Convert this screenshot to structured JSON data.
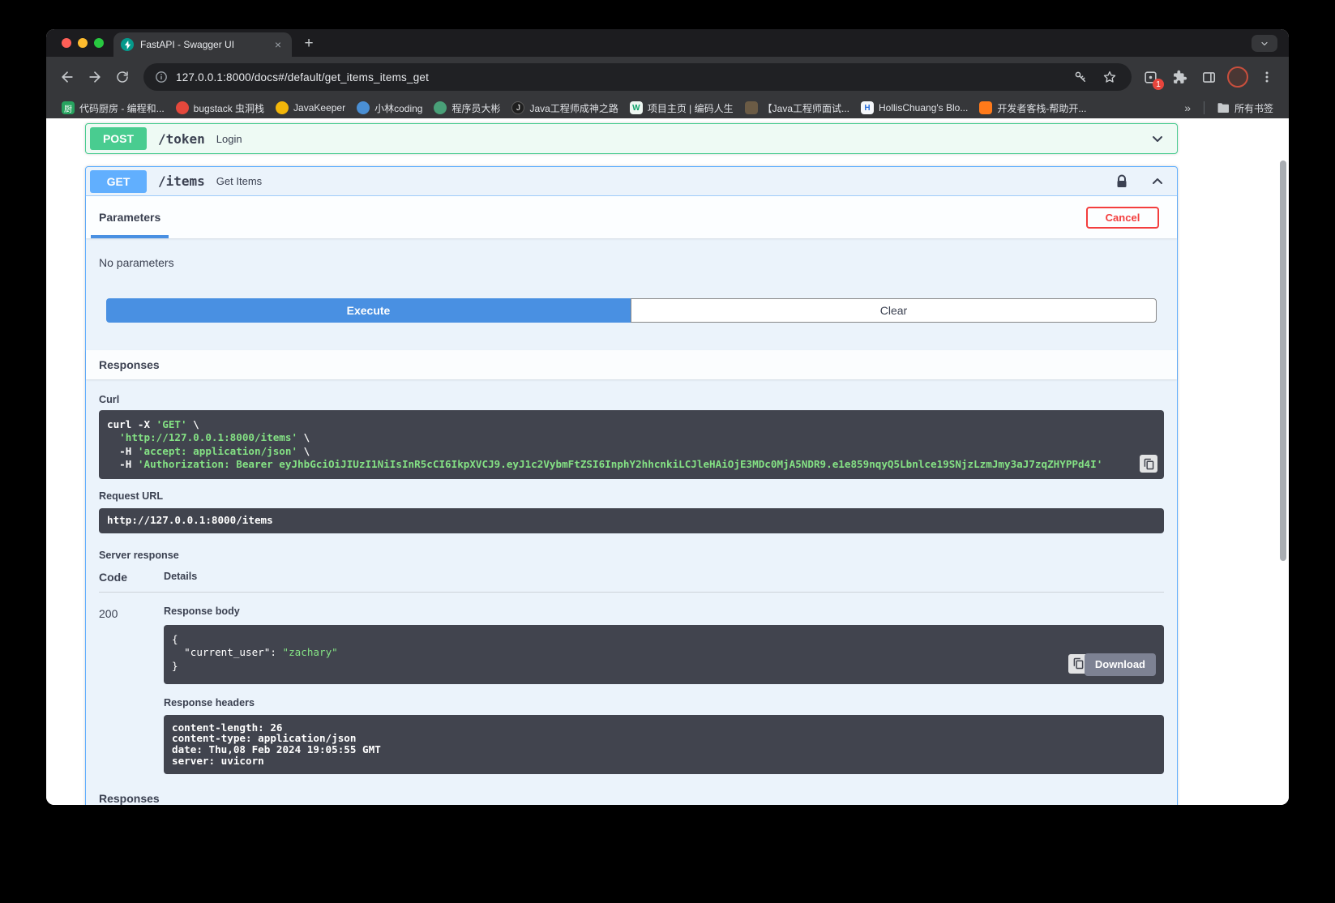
{
  "colors": {
    "get_accent": "#61affe",
    "post_accent": "#49cc90",
    "execute_blue": "#4990e2",
    "cancel_red": "#f33e3e",
    "code_background": "#41444e",
    "code_string_green": "#84e184",
    "download_gray": "#7d8293"
  },
  "browser": {
    "tab_title": "FastAPI - Swagger UI",
    "tab_close_glyph": "×",
    "new_tab_glyph": "+",
    "url": "127.0.0.1:8000/docs#/default/get_items_items_get",
    "extension_badge": "1"
  },
  "bookmarks": {
    "items": [
      {
        "label": "代码厨房 - 编程和...",
        "glyph": "厨"
      },
      {
        "label": "bugstack 虫洞栈",
        "glyph": ""
      },
      {
        "label": "JavaKeeper",
        "glyph": ""
      },
      {
        "label": "小林coding",
        "glyph": ""
      },
      {
        "label": "程序员大彬",
        "glyph": ""
      },
      {
        "label": "Java工程师成神之路",
        "glyph": "J"
      },
      {
        "label": "项目主页 | 编码人生",
        "glyph": "W"
      },
      {
        "label": "【Java工程师面试...",
        "glyph": ""
      },
      {
        "label": "HollisChuang's Blo...",
        "glyph": "H"
      },
      {
        "label": "开发者客栈-帮助开...",
        "glyph": ""
      }
    ],
    "overflow": "»",
    "all_label": "所有书签"
  },
  "swagger": {
    "post": {
      "method": "POST",
      "path": "/token",
      "summary": "Login"
    },
    "get": {
      "method": "GET",
      "path": "/items",
      "summary": "Get Items"
    },
    "parameters_tab": "Parameters",
    "cancel": "Cancel",
    "no_parameters": "No parameters",
    "execute": "Execute",
    "clear": "Clear",
    "responses_title": "Responses",
    "curl_title": "Curl",
    "curl": {
      "l1a": "curl -X ",
      "l1b": "'GET'",
      "l1c": " \\",
      "l2a": "  ",
      "l2b": "'http://127.0.0.1:8000/items'",
      "l2c": " \\",
      "l3a": "  -H ",
      "l3b": "'accept: application/json'",
      "l3c": " \\",
      "l4a": "  -H ",
      "l4b": "'Authorization: Bearer eyJhbGciOiJIUzI1NiIsInR5cCI6IkpXVCJ9.eyJ1c2VybmFtZSI6InphY2hhcnkiLCJleHAiOjE3MDc0MjA5NDR9.e1e859nqyQ5Lbnlce19SNjzLzmJmy3aJ7zqZHYPPd4I'"
    },
    "request_url_title": "Request URL",
    "request_url": "http://127.0.0.1:8000/items",
    "server_response_title": "Server response",
    "code_header": "Code",
    "details_header": "Details",
    "status_code": "200",
    "response_body_title": "Response body",
    "response_body": {
      "l1": "{",
      "l2pre": "  ",
      "key": "\"current_user\"",
      "sep": ": ",
      "val": "\"zachary\"",
      "l3": "}"
    },
    "download": "Download",
    "response_headers_title": "Response headers",
    "response_headers": [
      "content-length: 26",
      "content-type: application/json",
      "date: Thu,08 Feb 2024 19:05:55 GMT",
      "server: uvicorn"
    ],
    "responses_footer": "Responses"
  }
}
